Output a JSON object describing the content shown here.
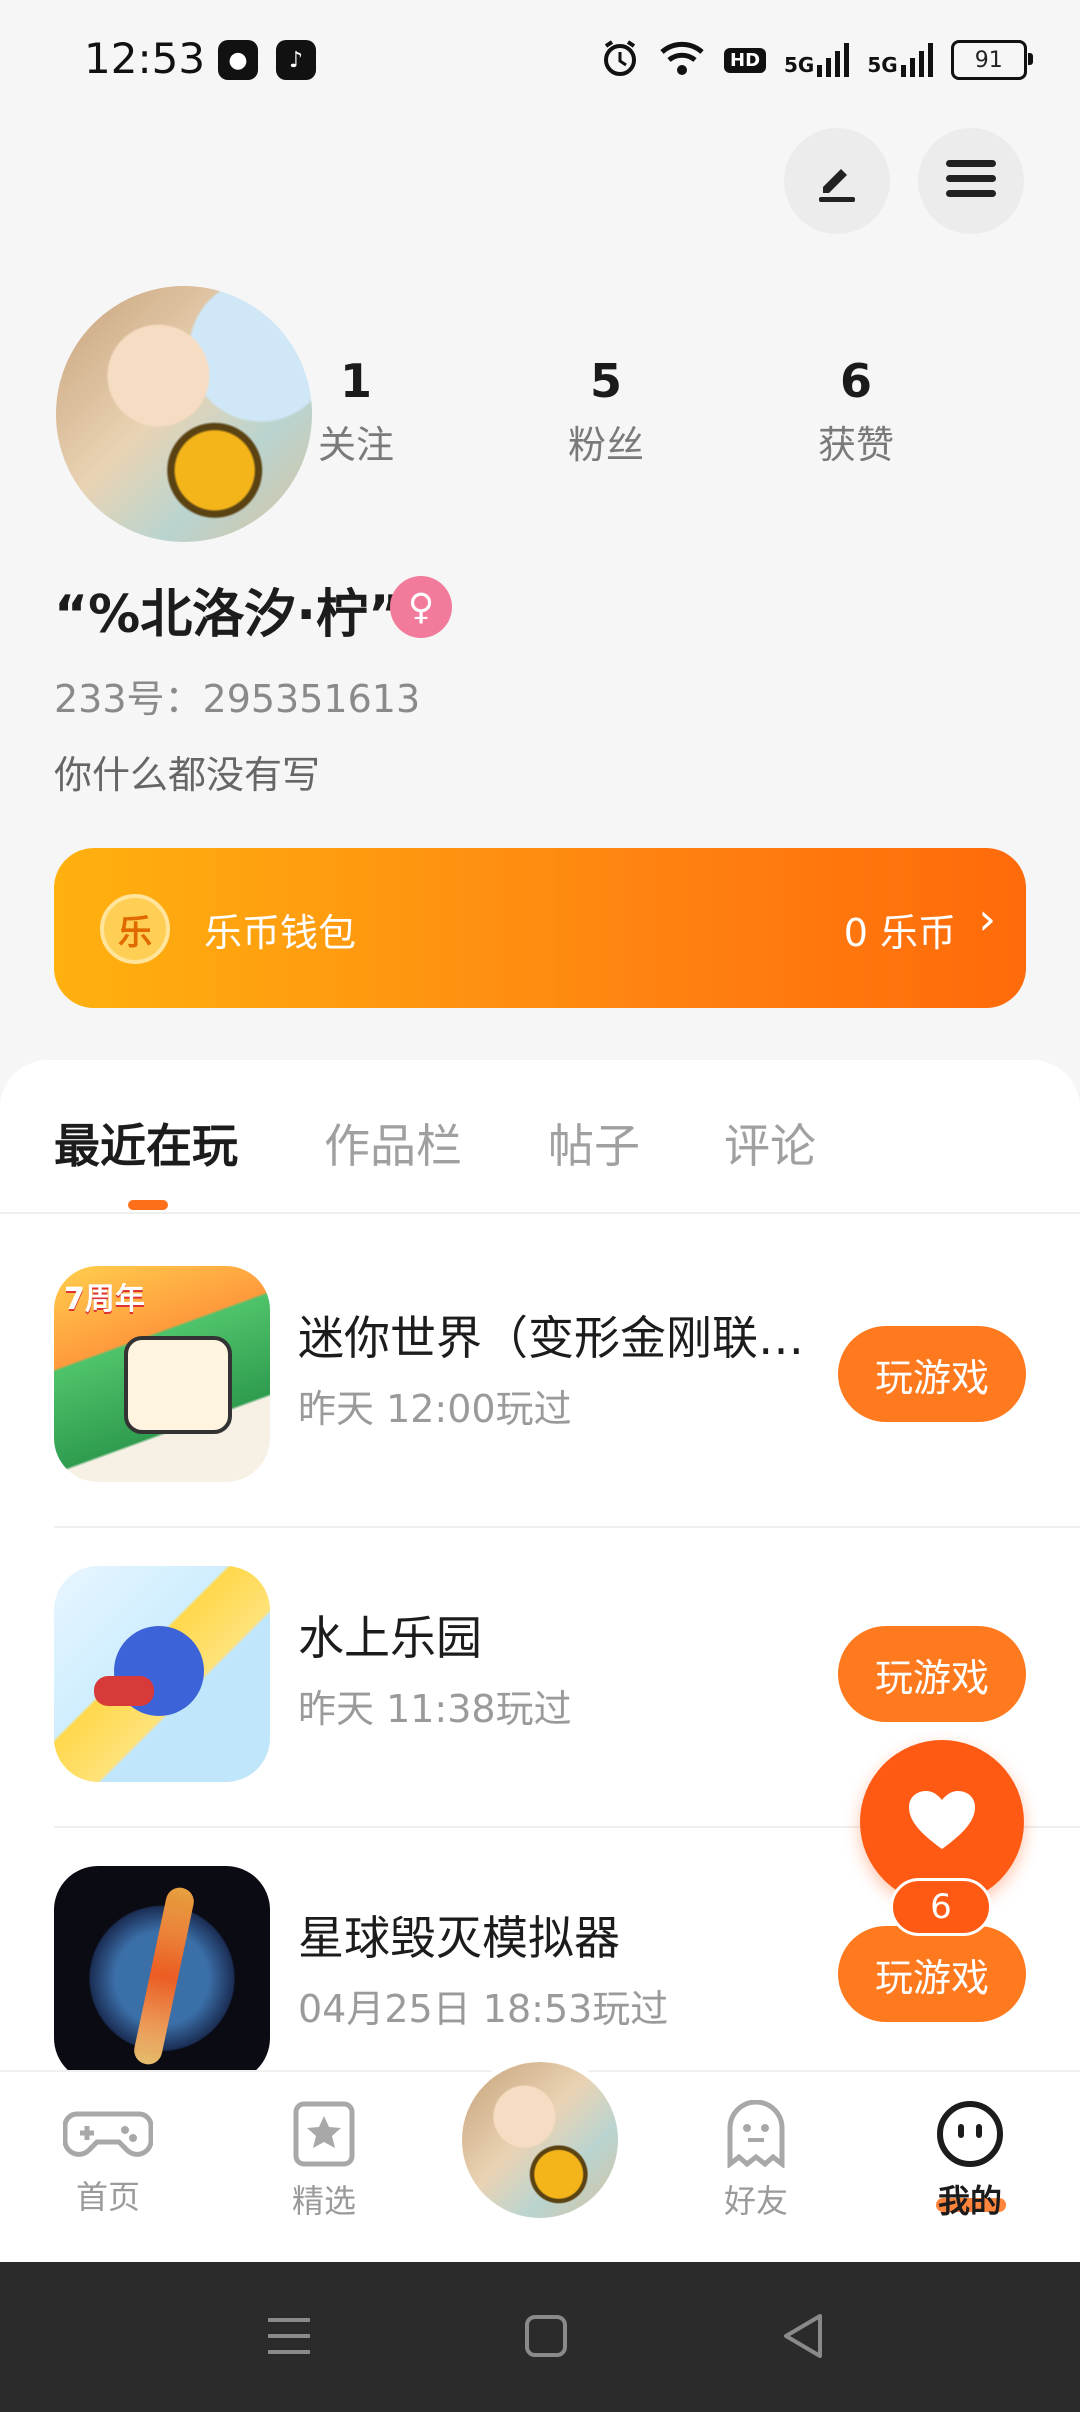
{
  "status_bar": {
    "time": "12:53",
    "hd_label": "HD",
    "sig1": "5G",
    "sig2": "5G",
    "battery": "91"
  },
  "header": {
    "edit_icon": "edit-icon",
    "menu_icon": "menu-icon"
  },
  "profile": {
    "stats": [
      {
        "value": "1",
        "label": "关注"
      },
      {
        "value": "5",
        "label": "粉丝"
      },
      {
        "value": "6",
        "label": "获赞"
      }
    ],
    "username": "“%北洛汐·柠”",
    "gender_symbol": "♀",
    "uid": "233号：295351613",
    "bio": "你什么都没有写"
  },
  "wallet": {
    "coin_symbol": "乐",
    "label": "乐币钱包",
    "balance": "0 乐币",
    "chevron": "›"
  },
  "tabs": [
    "最近在玩",
    "作品栏",
    "帖子",
    "评论"
  ],
  "games": [
    {
      "title": "迷你世界（变形金刚联…",
      "time": "昨天 12:00玩过",
      "button": "玩游戏"
    },
    {
      "title": "水上乐园",
      "time": "昨天 11:38玩过",
      "button": "玩游戏"
    },
    {
      "title": "星球毁灭模拟器",
      "time": "04月25日 18:53玩过",
      "button": "玩游戏"
    }
  ],
  "game_icon_badge": "7周年",
  "like_fab": {
    "count": "6"
  },
  "bottom_nav": [
    {
      "label": "首页",
      "icon": "gamepad-icon"
    },
    {
      "label": "精选",
      "icon": "star-icon"
    },
    {
      "label": "好友",
      "icon": "ghost-icon"
    },
    {
      "label": "我的",
      "icon": "face-icon"
    }
  ],
  "colors": {
    "accent": "#ff7a1f",
    "wallet_start": "#ffb10f",
    "wallet_end": "#ff6a0a"
  }
}
